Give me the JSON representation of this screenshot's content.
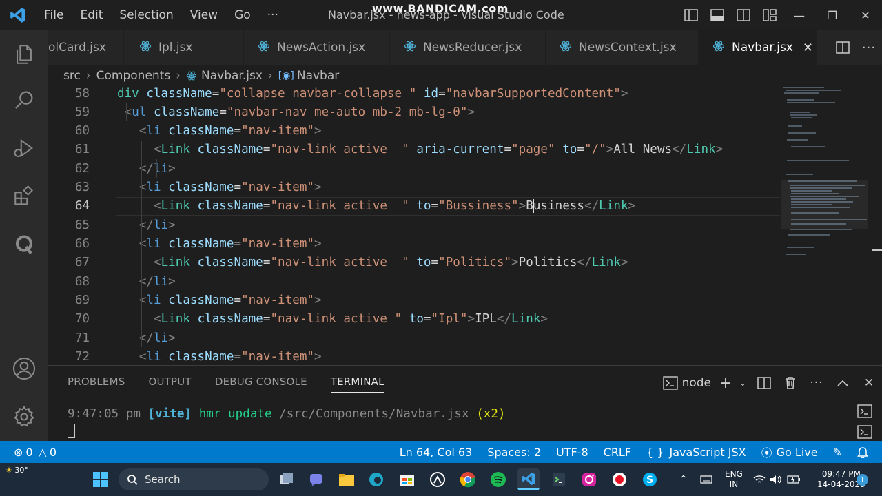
{
  "titlebar": {
    "menu": [
      "File",
      "Edit",
      "Selection",
      "View",
      "Go",
      "···"
    ],
    "title": "Navbar.jsx - news-app - Visual Studio Code",
    "watermark": "www.BANDICAM.com"
  },
  "tabs": [
    {
      "label": "olCard.jsx",
      "active": false
    },
    {
      "label": "Ipl.jsx",
      "active": false
    },
    {
      "label": "NewsAction.jsx",
      "active": false
    },
    {
      "label": "NewsReducer.jsx",
      "active": false
    },
    {
      "label": "NewsContext.jsx",
      "active": false
    },
    {
      "label": "Navbar.jsx",
      "active": true
    }
  ],
  "breadcrumb": {
    "items": [
      "src",
      "Components",
      "Navbar.jsx",
      "Navbar"
    ]
  },
  "editor": {
    "current_line": 64,
    "lines": [
      {
        "n": "58",
        "tokens": [
          [
            "t-comp",
            "div "
          ],
          [
            "t-attr",
            "className"
          ],
          [
            "t-txt",
            "="
          ],
          [
            "t-str",
            "\"collapse navbar-collapse \""
          ],
          [
            "t-txt",
            " "
          ],
          [
            "t-attr",
            "id"
          ],
          [
            "t-txt",
            "="
          ],
          [
            "t-str",
            "\"navbarSupportedContent\""
          ],
          [
            "t-punc",
            ">"
          ]
        ]
      },
      {
        "n": "59",
        "tokens": [
          [
            "t-txt",
            " "
          ],
          [
            "t-punc",
            "<"
          ],
          [
            "t-tag",
            "ul"
          ],
          [
            "t-txt",
            " "
          ],
          [
            "t-attr",
            "className"
          ],
          [
            "t-txt",
            "="
          ],
          [
            "t-str",
            "\"navbar-nav me-auto mb-2 mb-lg-0\""
          ],
          [
            "t-punc",
            ">"
          ]
        ]
      },
      {
        "n": "60",
        "tokens": [
          [
            "t-txt",
            "   "
          ],
          [
            "t-punc",
            "<"
          ],
          [
            "t-tag",
            "li"
          ],
          [
            "t-txt",
            " "
          ],
          [
            "t-attr",
            "className"
          ],
          [
            "t-txt",
            "="
          ],
          [
            "t-str",
            "\"nav-item\""
          ],
          [
            "t-punc",
            ">"
          ]
        ]
      },
      {
        "n": "61",
        "tokens": [
          [
            "t-txt",
            "     "
          ],
          [
            "t-punc",
            "<"
          ],
          [
            "t-comp",
            "Link"
          ],
          [
            "t-txt",
            " "
          ],
          [
            "t-attr",
            "className"
          ],
          [
            "t-txt",
            "="
          ],
          [
            "t-str",
            "\"nav-link active  \""
          ],
          [
            "t-txt",
            " "
          ],
          [
            "t-attr",
            "aria-current"
          ],
          [
            "t-txt",
            "="
          ],
          [
            "t-str",
            "\"page\""
          ],
          [
            "t-txt",
            " "
          ],
          [
            "t-attr",
            "to"
          ],
          [
            "t-txt",
            "="
          ],
          [
            "t-str",
            "\"/\""
          ],
          [
            "t-punc",
            ">"
          ],
          [
            "t-txt",
            "All News"
          ],
          [
            "t-punc",
            "</"
          ],
          [
            "t-comp",
            "Link"
          ],
          [
            "t-punc",
            ">"
          ]
        ]
      },
      {
        "n": "62",
        "tokens": [
          [
            "t-txt",
            "   "
          ],
          [
            "t-punc",
            "</"
          ],
          [
            "t-tag",
            "li"
          ],
          [
            "t-punc",
            ">"
          ]
        ]
      },
      {
        "n": "63",
        "tokens": [
          [
            "t-txt",
            "   "
          ],
          [
            "t-punc",
            "<"
          ],
          [
            "t-tag",
            "li"
          ],
          [
            "t-txt",
            " "
          ],
          [
            "t-attr",
            "className"
          ],
          [
            "t-txt",
            "="
          ],
          [
            "t-str",
            "\"nav-item\""
          ],
          [
            "t-punc",
            ">"
          ]
        ]
      },
      {
        "n": "64",
        "tokens": [
          [
            "t-txt",
            "     "
          ],
          [
            "t-punc",
            "<"
          ],
          [
            "t-comp",
            "Link"
          ],
          [
            "t-txt",
            " "
          ],
          [
            "t-attr",
            "className"
          ],
          [
            "t-txt",
            "="
          ],
          [
            "t-str",
            "\"nav-link active  \""
          ],
          [
            "t-txt",
            " "
          ],
          [
            "t-attr",
            "to"
          ],
          [
            "t-txt",
            "="
          ],
          [
            "t-str",
            "\"Bussiness\""
          ],
          [
            "t-punc",
            ">"
          ],
          [
            "t-txt",
            "B"
          ],
          [
            "cursor",
            ""
          ],
          [
            "t-txt",
            "usiness"
          ],
          [
            "t-punc",
            "</"
          ],
          [
            "t-comp",
            "Link"
          ],
          [
            "t-punc",
            ">"
          ]
        ]
      },
      {
        "n": "65",
        "tokens": [
          [
            "t-txt",
            "   "
          ],
          [
            "t-punc",
            "</"
          ],
          [
            "t-tag",
            "li"
          ],
          [
            "t-punc",
            ">"
          ]
        ]
      },
      {
        "n": "66",
        "tokens": [
          [
            "t-txt",
            "   "
          ],
          [
            "t-punc",
            "<"
          ],
          [
            "t-tag",
            "li"
          ],
          [
            "t-txt",
            " "
          ],
          [
            "t-attr",
            "className"
          ],
          [
            "t-txt",
            "="
          ],
          [
            "t-str",
            "\"nav-item\""
          ],
          [
            "t-punc",
            ">"
          ]
        ]
      },
      {
        "n": "67",
        "tokens": [
          [
            "t-txt",
            "     "
          ],
          [
            "t-punc",
            "<"
          ],
          [
            "t-comp",
            "Link"
          ],
          [
            "t-txt",
            " "
          ],
          [
            "t-attr",
            "className"
          ],
          [
            "t-txt",
            "="
          ],
          [
            "t-str",
            "\"nav-link active  \""
          ],
          [
            "t-txt",
            " "
          ],
          [
            "t-attr",
            "to"
          ],
          [
            "t-txt",
            "="
          ],
          [
            "t-str",
            "\"Politics\""
          ],
          [
            "t-punc",
            ">"
          ],
          [
            "t-txt",
            "Politics"
          ],
          [
            "t-punc",
            "</"
          ],
          [
            "t-comp",
            "Link"
          ],
          [
            "t-punc",
            ">"
          ]
        ]
      },
      {
        "n": "68",
        "tokens": [
          [
            "t-txt",
            "   "
          ],
          [
            "t-punc",
            "</"
          ],
          [
            "t-tag",
            "li"
          ],
          [
            "t-punc",
            ">"
          ]
        ]
      },
      {
        "n": "69",
        "tokens": [
          [
            "t-txt",
            "   "
          ],
          [
            "t-punc",
            "<"
          ],
          [
            "t-tag",
            "li"
          ],
          [
            "t-txt",
            " "
          ],
          [
            "t-attr",
            "className"
          ],
          [
            "t-txt",
            "="
          ],
          [
            "t-str",
            "\"nav-item\""
          ],
          [
            "t-punc",
            ">"
          ]
        ]
      },
      {
        "n": "70",
        "tokens": [
          [
            "t-txt",
            "     "
          ],
          [
            "t-punc",
            "<"
          ],
          [
            "t-comp",
            "Link"
          ],
          [
            "t-txt",
            " "
          ],
          [
            "t-attr",
            "className"
          ],
          [
            "t-txt",
            "="
          ],
          [
            "t-str",
            "\"nav-link active \""
          ],
          [
            "t-txt",
            " "
          ],
          [
            "t-attr",
            "to"
          ],
          [
            "t-txt",
            "="
          ],
          [
            "t-str",
            "\"Ipl\""
          ],
          [
            "t-punc",
            ">"
          ],
          [
            "t-txt",
            "IPL"
          ],
          [
            "t-punc",
            "</"
          ],
          [
            "t-comp",
            "Link"
          ],
          [
            "t-punc",
            ">"
          ]
        ]
      },
      {
        "n": "71",
        "tokens": [
          [
            "t-txt",
            "   "
          ],
          [
            "t-punc",
            "</"
          ],
          [
            "t-tag",
            "li"
          ],
          [
            "t-punc",
            ">"
          ]
        ]
      },
      {
        "n": "72",
        "tokens": [
          [
            "t-txt",
            "   "
          ],
          [
            "t-punc",
            "<"
          ],
          [
            "t-tag",
            "li"
          ],
          [
            "t-txt",
            " "
          ],
          [
            "t-attr",
            "className"
          ],
          [
            "t-txt",
            "="
          ],
          [
            "t-str",
            "\"nav-item\""
          ],
          [
            "t-punc",
            ">"
          ]
        ]
      }
    ]
  },
  "panel": {
    "tabs": [
      "PROBLEMS",
      "OUTPUT",
      "DEBUG CONSOLE",
      "TERMINAL"
    ],
    "active_tab": "TERMINAL",
    "terminal_name": "node",
    "terminal_output": {
      "time": "9:47:05 pm",
      "tag": "[vite]",
      "msg": "hmr update",
      "path": "/src/Components/Navbar.jsx",
      "count": "(x2)"
    }
  },
  "statusbar": {
    "errors": "0",
    "warnings": "0",
    "position": "Ln 64, Col 63",
    "spaces": "Spaces: 2",
    "encoding": "UTF-8",
    "eol": "CRLF",
    "language": "JavaScript JSX",
    "golive": "Go Live"
  },
  "taskbar": {
    "weather": "30°",
    "search_placeholder": "Search",
    "lang_line1": "ENG",
    "lang_line2": "IN",
    "time": "09:47 PM",
    "date": "14-04-2023",
    "notifications": "1"
  },
  "colors": {
    "accent": "#007acc",
    "editor_bg": "#1e1e1e",
    "activity_bg": "#2b2b2b",
    "taskbar_bg": "#1c2a3a"
  }
}
